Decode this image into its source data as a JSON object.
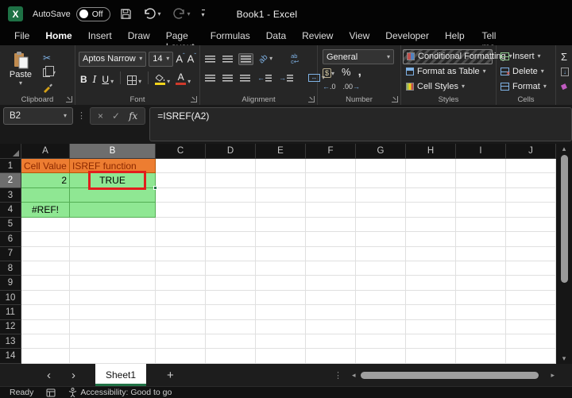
{
  "title_bar": {
    "autosave_label": "AutoSave",
    "autosave_state": "Off",
    "workbook_title": "Book1  -  Excel"
  },
  "menu": {
    "tabs": [
      "File",
      "Home",
      "Insert",
      "Draw",
      "Page Layout",
      "Formulas",
      "Data",
      "Review",
      "View",
      "Developer",
      "Help"
    ],
    "active_tab": "Home",
    "search_label": "Tell me what you want to do"
  },
  "ribbon": {
    "clipboard": {
      "group_label": "Clipboard",
      "paste_label": "Paste"
    },
    "font": {
      "group_label": "Font",
      "font_name": "Aptos Narrow",
      "font_size": "14",
      "bold": "B",
      "italic": "I",
      "underline": "U"
    },
    "alignment": {
      "group_label": "Alignment"
    },
    "number": {
      "group_label": "Number",
      "format": "General"
    },
    "styles": {
      "group_label": "Styles",
      "items": [
        "Conditional Formatting",
        "Format as Table",
        "Cell Styles"
      ]
    },
    "cells": {
      "group_label": "Cells",
      "items": [
        "Insert",
        "Delete",
        "Format"
      ]
    }
  },
  "formula_bar": {
    "name_box": "B2",
    "formula": "=ISREF(A2)"
  },
  "grid": {
    "columns": [
      "A",
      "B",
      "C",
      "D",
      "E",
      "F",
      "G",
      "H",
      "I",
      "J"
    ],
    "row_count": 14,
    "selected_cell": "B2",
    "selected_column": "B",
    "selected_row": 2,
    "cells": {
      "A1": {
        "text": "Cell Value",
        "kind": "orange",
        "align": "left"
      },
      "B1": {
        "text": "ISREF function",
        "kind": "orange",
        "align": "left"
      },
      "A2": {
        "text": "2",
        "kind": "green",
        "align": "right"
      },
      "B2": {
        "text": "TRUE",
        "kind": "green",
        "align": "center",
        "annotated": true,
        "selected": true
      },
      "A3": {
        "kind": "green"
      },
      "B3": {
        "kind": "green"
      },
      "A4": {
        "text": "#REF!",
        "kind": "green",
        "align": "center"
      },
      "B4": {
        "kind": "green"
      }
    }
  },
  "sheet_bar": {
    "sheet_name": "Sheet1"
  },
  "status_bar": {
    "ready_label": "Ready",
    "accessibility_label": "Accessibility: Good to go"
  },
  "icons": {
    "chevron_down": "▾",
    "chevron_up": "▴",
    "chevron_left": "◂",
    "chevron_right": "▸",
    "nav_left": "‹",
    "nav_right": "›",
    "scissors": "✂",
    "sigma": "Σ",
    "percent": "%",
    "comma": ",",
    "dollar": "$",
    "plus": "+",
    "dots_v": "⋮",
    "cancel": "×",
    "check": "✓",
    "fx": "fx",
    "caret": "ˆ",
    "caret_down": "ˇ",
    "arrow_down": "↓",
    "orient_ab": "ab",
    "wrap_ab": "ab",
    "wrap_c": "c↩",
    "merge_arrows": "↔",
    "dec_inc": "←.0",
    "dec_dec": ".00→",
    "eraser_diamond": "◆",
    "cell_x": "X"
  },
  "colors": {
    "orange_fill": "#ED7D31",
    "orange_text": "#8B2800",
    "green_fill": "#8FE793",
    "green_border": "#54AE54",
    "annotation_red": "#E21D1D",
    "selection_grey": "#6E6E6E",
    "excel_green": "#1E7145",
    "tab_underline": "#217346"
  }
}
